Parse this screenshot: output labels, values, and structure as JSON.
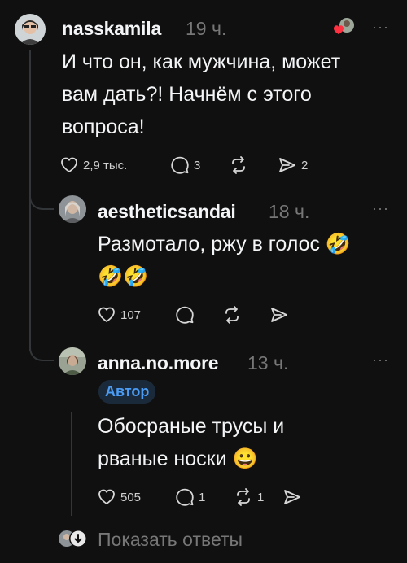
{
  "comments": [
    {
      "username": "nasskamila",
      "time": "19 ч.",
      "text_lines": [
        "И что он, как мужчина, может",
        "вам дать?! Начнём с этого",
        "вопроса!"
      ],
      "likes": "2,9 тыс.",
      "replies": "3",
      "reposts": "",
      "shares": "2"
    },
    {
      "username": "aestheticsandai",
      "time": "18 ч.",
      "text_lines": [
        "Размотало, ржу в голос 🤣",
        "🤣🤣"
      ],
      "likes": "107",
      "replies": "",
      "reposts": "",
      "shares": ""
    },
    {
      "username": "anna.no.more",
      "time": "13 ч.",
      "badge": "Автор",
      "text_lines": [
        "Обосраные трусы и",
        "рваные носки 😀"
      ],
      "likes": "505",
      "replies": "1",
      "reposts": "1",
      "shares": ""
    }
  ],
  "more_label": "···",
  "show_replies_label": "Показать ответы",
  "colors": {
    "background": "#101010",
    "text": "#f3f5f7",
    "muted": "#777777",
    "badge_bg": "#1b2a3a",
    "badge_text": "#4a9cf5",
    "thread_line": "#333638"
  }
}
